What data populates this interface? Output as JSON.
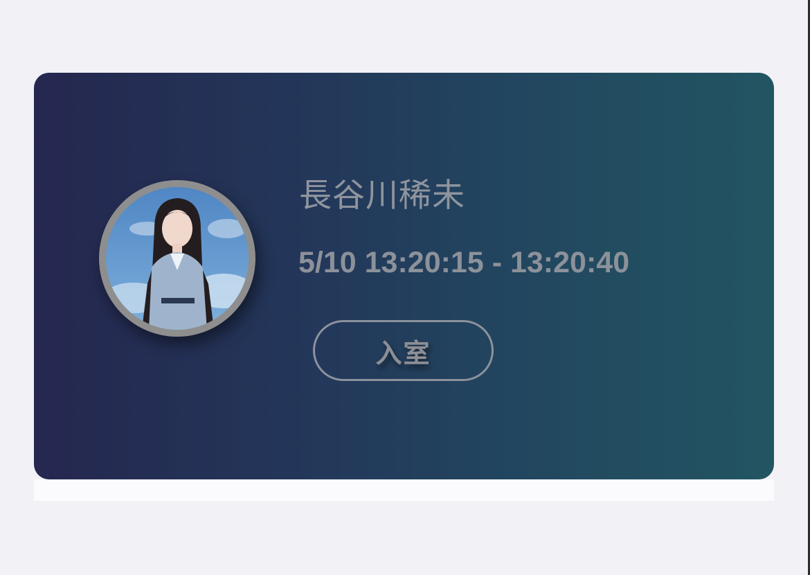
{
  "card": {
    "member_name": "長谷川稀未",
    "session_time": "5/10 13:20:15 - 13:20:40",
    "enter_button_label": "入室",
    "avatar_icon": "member-avatar-photo"
  },
  "colors": {
    "background": "#f2f2f6",
    "card_gradient_start": "#25274f",
    "card_gradient_end": "#225562",
    "text": "#8f949e",
    "button_border": "#8c929c"
  }
}
